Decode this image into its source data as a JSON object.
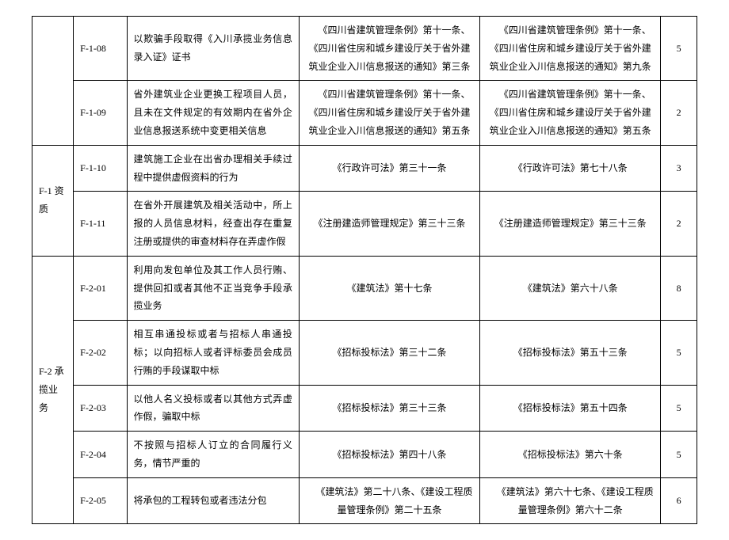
{
  "table": {
    "categories": [
      {
        "label": "",
        "span": 2
      },
      {
        "label": "F-1 资质",
        "span": 2
      },
      {
        "label": "F-2 承揽业务",
        "span": 5
      }
    ],
    "rows": [
      {
        "code": "F-1-08",
        "behavior": "以欺骗手段取得《入川承揽业务信息录入证》证书",
        "law1": "《四川省建筑管理条例》第十一条、《四川省住房和城乡建设厅关于省外建筑业企业入川信息报送的通知》第三条",
        "law2": "《四川省建筑管理条例》第十一条、《四川省住房和城乡建设厅关于省外建筑业企业入川信息报送的通知》第九条",
        "score": "5"
      },
      {
        "code": "F-1-09",
        "behavior": "省外建筑业企业更换工程项目人员，且未在文件规定的有效期内在省外企业信息报送系统中变更相关信息",
        "law1": "《四川省建筑管理条例》第十一条、《四川省住房和城乡建设厅关于省外建筑业企业入川信息报送的通知》第五条",
        "law2": "《四川省建筑管理条例》第十一条、《四川省住房和城乡建设厅关于省外建筑业企业入川信息报送的通知》第五条",
        "score": "2"
      },
      {
        "code": "F-1-10",
        "behavior": "建筑施工企业在出省办理相关手续过程中提供虚假资料的行为",
        "law1": "《行政许可法》第三十一条",
        "law2": "《行政许可法》第七十八条",
        "score": "3"
      },
      {
        "code": "F-1-11",
        "behavior": "在省外开展建筑及相关活动中，所上报的人员信息材料，经查出存在重复注册或提供的审查材料存在弄虚作假",
        "law1": "《注册建造师管理规定》第三十三条",
        "law2": "《注册建造师管理规定》第三十三条",
        "score": "2"
      },
      {
        "code": "F-2-01",
        "behavior": "利用向发包单位及其工作人员行贿、提供回扣或者其他不正当竞争手段承揽业务",
        "law1": "《建筑法》第十七条",
        "law2": "《建筑法》第六十八条",
        "score": "8"
      },
      {
        "code": "F-2-02",
        "behavior": "相互串通投标或者与招标人串通投标；以向招标人或者评标委员会成员行贿的手段谋取中标",
        "law1": "《招标投标法》第三十二条",
        "law2": "《招标投标法》第五十三条",
        "score": "5"
      },
      {
        "code": "F-2-03",
        "behavior": "以他人名义投标或者以其他方式弄虚作假，骗取中标",
        "law1": "《招标投标法》第三十三条",
        "law2": "《招标投标法》第五十四条",
        "score": "5"
      },
      {
        "code": "F-2-04",
        "behavior": "不按照与招标人订立的合同履行义务，情节严重的",
        "law1": "《招标投标法》第四十八条",
        "law2": "《招标投标法》第六十条",
        "score": "5"
      },
      {
        "code": "F-2-05",
        "behavior": "将承包的工程转包或者违法分包",
        "law1": "《建筑法》第二十八条、《建设工程质量管理条例》第二十五条",
        "law2": "《建筑法》第六十七条、《建设工程质量管理条例》第六十二条",
        "score": "6"
      }
    ]
  }
}
